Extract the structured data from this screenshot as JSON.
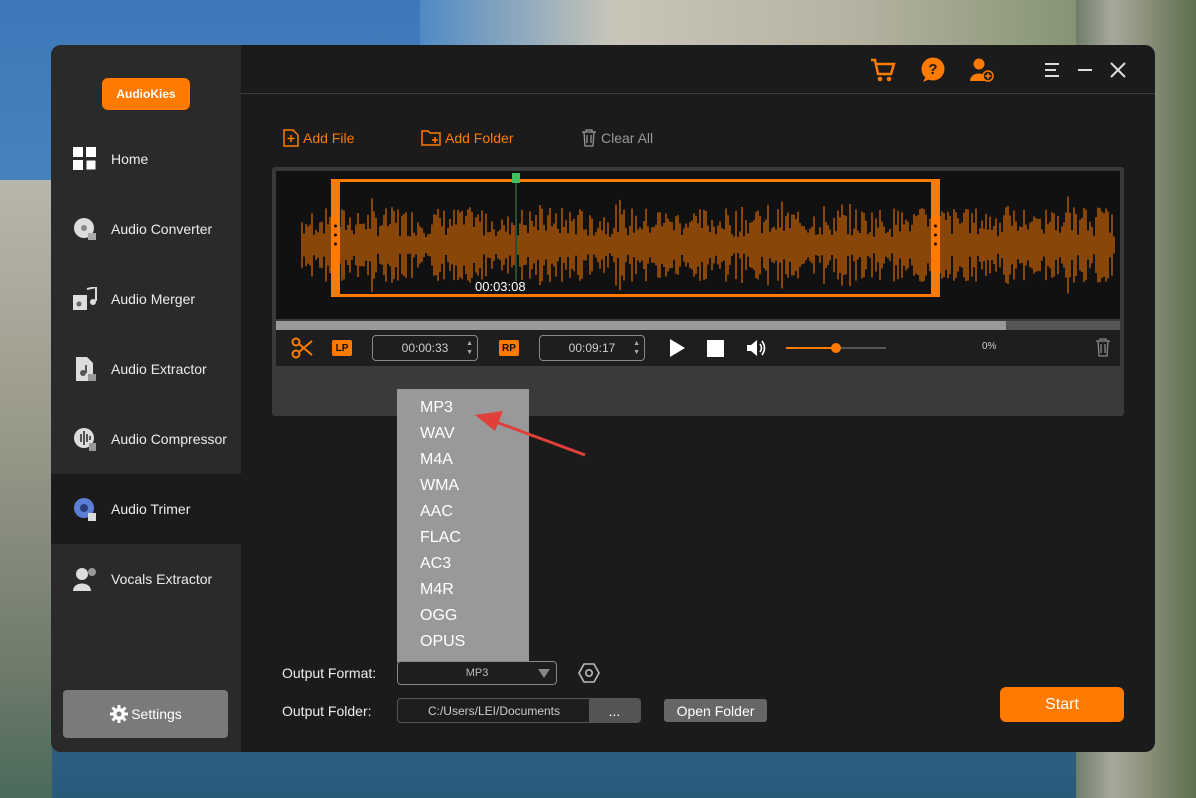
{
  "app": {
    "logo": "AudioKies"
  },
  "sidebar": {
    "items": [
      {
        "label": "Home",
        "icon": "grid-icon"
      },
      {
        "label": "Audio Converter",
        "icon": "disc-icon"
      },
      {
        "label": "Audio Merger",
        "icon": "music-merge-icon"
      },
      {
        "label": "Audio Extractor",
        "icon": "file-music-icon"
      },
      {
        "label": "Audio Compressor",
        "icon": "compress-icon"
      },
      {
        "label": "Audio Trimer",
        "icon": "trim-icon",
        "active": true
      },
      {
        "label": "Vocals Extractor",
        "icon": "user-voice-icon"
      }
    ],
    "settings_label": "Settings"
  },
  "toolbar": {
    "add_file": "Add File",
    "add_folder": "Add Folder",
    "clear_all": "Clear All"
  },
  "player": {
    "current_time": "00:03:08",
    "lp_label": "LP",
    "rp_label": "RP",
    "left_point": "00:00:33",
    "right_point": "00:09:17",
    "percent": "0%",
    "progress_fraction": 0.865,
    "volume_fraction": 0.5
  },
  "format_dropdown": {
    "options": [
      "MP3",
      "WAV",
      "M4A",
      "WMA",
      "AAC",
      "FLAC",
      "AC3",
      "M4R",
      "OGG",
      "OPUS"
    ]
  },
  "output": {
    "format_label": "Output Format:",
    "format_value": "MP3",
    "folder_label": "Output Folder:",
    "folder_value": "C:/Users/LEI/Documents",
    "browse_label": "...",
    "open_folder": "Open Folder"
  },
  "start_label": "Start",
  "colors": {
    "accent": "#ff7a00",
    "window_bg": "#1b1b1b",
    "sidebar_bg": "#2a2a2a"
  }
}
